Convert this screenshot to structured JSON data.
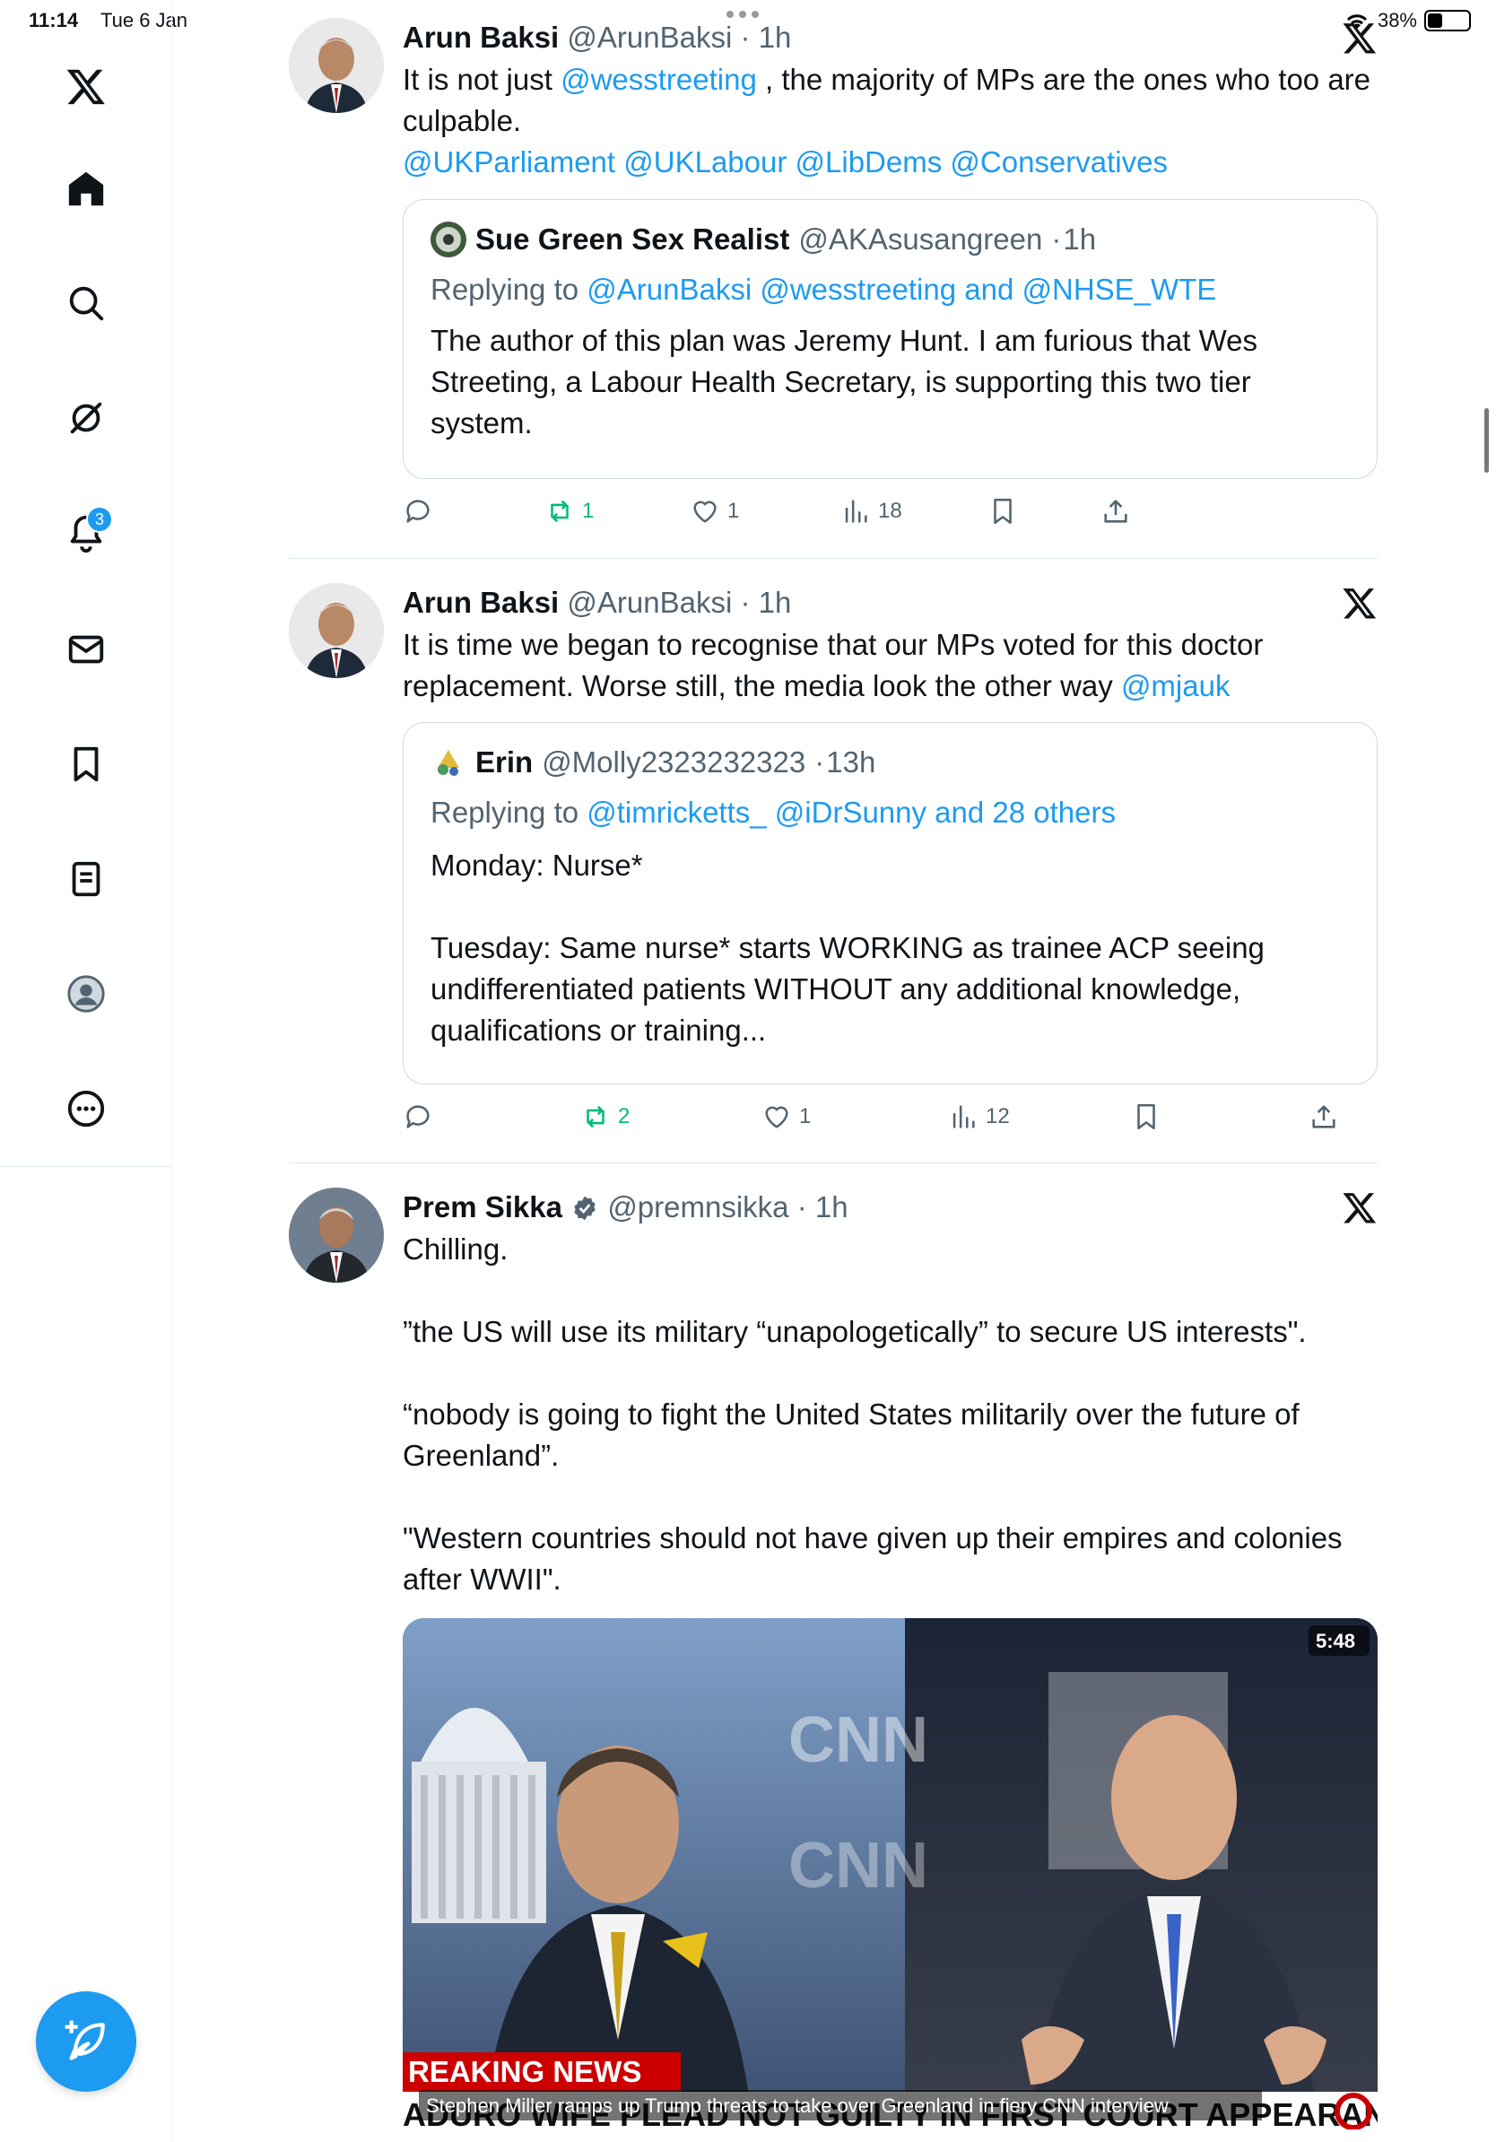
{
  "status_bar": {
    "time": "11:14",
    "date": "Tue 6 Jan",
    "battery": "38%"
  },
  "sidebar": {
    "items": [
      {
        "name": "x-logo-icon"
      },
      {
        "name": "home-icon"
      },
      {
        "name": "search-icon"
      },
      {
        "name": "grok-icon"
      },
      {
        "name": "notifications-icon",
        "badge": "3"
      },
      {
        "name": "messages-icon"
      },
      {
        "name": "bookmarks-icon"
      },
      {
        "name": "lists-icon"
      },
      {
        "name": "profile-icon"
      },
      {
        "name": "more-icon"
      }
    ]
  },
  "colors": {
    "accent": "#1d9bf0",
    "text": "#0f1419",
    "muted": "#536471",
    "retweet": "#00ba7c"
  },
  "tweets": [
    {
      "author_name": "Arun Baksi",
      "author_handle": "@ArunBaksi",
      "time": "1h",
      "text_parts": [
        "It is not just ",
        "@wesstreeting",
        " , the majority of MPs are the ones who too are culpable."
      ],
      "mentions_line": "@UKParliament @UKLabour @LibDems @Conservatives",
      "quote": {
        "author_name": "Sue Green Sex Realist",
        "author_handle": "@AKAsusangreen",
        "time": "1h",
        "replying_prefix": "Replying to ",
        "replying_to": "@ArunBaksi @wesstreeting and @NHSE_WTE",
        "text": "The author of this plan was Jeremy Hunt. I am furious that Wes Streeting, a Labour Health Secretary, is supporting this two tier system."
      },
      "stats": {
        "reposts": "1",
        "likes": "1",
        "views": "18"
      }
    },
    {
      "author_name": "Arun Baksi",
      "author_handle": "@ArunBaksi",
      "time": "1h",
      "text_parts": [
        "It is time we began to recognise that our MPs voted for this doctor replacement. Worse still, the media look the other way ",
        "@mjauk"
      ],
      "quote": {
        "author_name": "Erin",
        "author_handle": "@Molly2323232323",
        "time": "13h",
        "replying_prefix": "Replying to ",
        "replying_to": "@timricketts_ @iDrSunny and 28 others",
        "text_line1": "Monday: Nurse*",
        "text_line2": "Tuesday: Same nurse* starts WORKING as trainee ACP seeing undifferentiated patients  WITHOUT any additional knowledge, qualifications or training..."
      },
      "stats": {
        "reposts": "2",
        "likes": "1",
        "views": "12"
      }
    },
    {
      "author_name": "Prem Sikka",
      "author_handle": "@premnsikka",
      "time": "1h",
      "para1": "Chilling.",
      "para2": "”the US will use its military “unapologetically” to secure US interests\".",
      "para3": "“nobody is going to fight the United States militarily over the future of Greenland”.",
      "para4": "\"Western countries should not have given up their empires and colonies after WWII\".",
      "media": {
        "duration": "5:48",
        "banner": "REAKING NEWS",
        "ticker": "ADURO WIFE PLEAD NOT GUILTY IN FIRST COURT APPEARANCE",
        "caption": "Stephen Miller ramps up Trump threats to take over Greenland in fiery CNN interview",
        "watermark": "CNN"
      }
    }
  ]
}
